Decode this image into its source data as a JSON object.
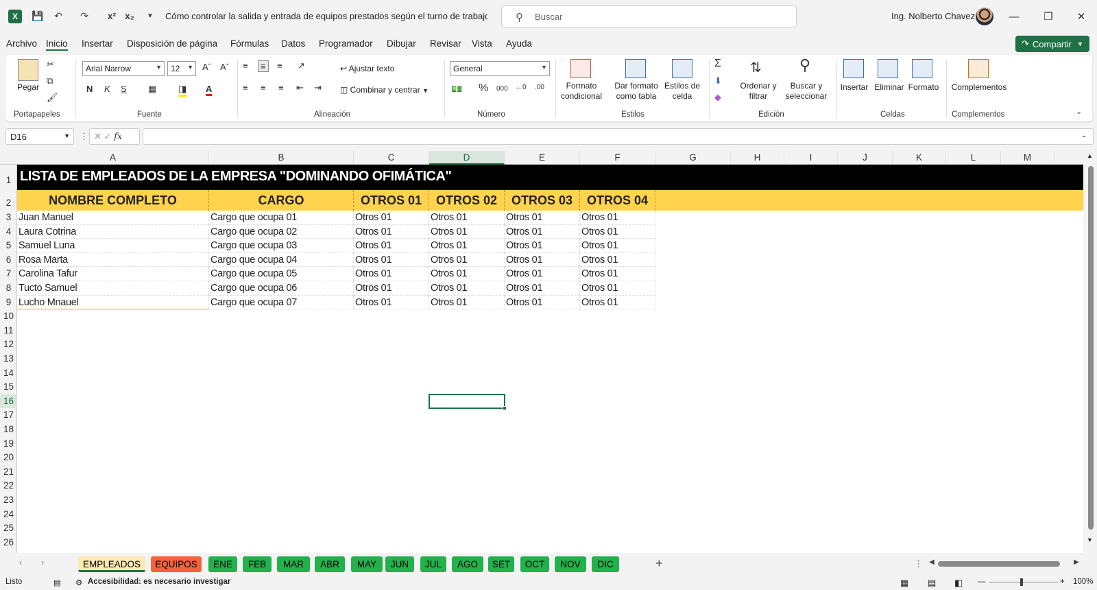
{
  "app": {
    "doc_title": "Cómo controlar la salida y entrada de equipos prestados según el turno de trabajo  -  E...",
    "search_placeholder": "Buscar",
    "user": "Ing. Nolberto Chavez",
    "share_label": "Compartir",
    "accent": "#1e7145"
  },
  "menu": [
    "Archivo",
    "Inicio",
    "Insertar",
    "Disposición de página",
    "Fórmulas",
    "Datos",
    "Programador",
    "Dibujar",
    "Revisar",
    "Vista",
    "Ayuda"
  ],
  "ribbon": {
    "groups": [
      "Portapapeles",
      "Fuente",
      "Alineación",
      "Número",
      "Estilos",
      "Edición",
      "Celdas",
      "Complementos"
    ],
    "paste": "Pegar",
    "font_name": "Arial Narrow",
    "font_size": "12",
    "bold": "N",
    "italic": "K",
    "underline": "S",
    "wrap_text": "Ajustar texto",
    "merge_center": "Combinar y centrar",
    "number_format": "General",
    "cond_format": [
      "Formato",
      "condicional"
    ],
    "table_format": [
      "Dar formato",
      "como tabla"
    ],
    "cell_styles": [
      "Estilos de",
      "celda"
    ],
    "sort_filter": [
      "Ordenar y",
      "filtrar"
    ],
    "find_select": [
      "Buscar y",
      "seleccionar"
    ],
    "insert": "Insertar",
    "delete": "Eliminar",
    "format": "Formato",
    "addins": "Complementos"
  },
  "formula_bar": {
    "name_box": "D16",
    "fx": "fx",
    "value": ""
  },
  "columns": [
    "A",
    "B",
    "C",
    "D",
    "E",
    "F",
    "G",
    "H",
    "I",
    "J",
    "K",
    "L",
    "M"
  ],
  "selected_column": "D",
  "rows": [
    "1",
    "2",
    "3",
    "4",
    "5",
    "6",
    "7",
    "8",
    "9",
    "10",
    "11",
    "12",
    "13",
    "14",
    "15",
    "16",
    "17",
    "18",
    "19",
    "20",
    "21",
    "22",
    "23",
    "24",
    "25",
    "26"
  ],
  "selected_row": "16",
  "sheet": {
    "title": "LISTA DE EMPLEADOS DE LA EMPRESA \"DOMINANDO OFIMÁTICA\"",
    "headers": [
      "NOMBRE COMPLETO",
      "CARGO",
      "OTROS 01",
      "OTROS 02",
      "OTROS 03",
      "OTROS 04"
    ],
    "data": [
      [
        "Juan Manuel",
        "Cargo que ocupa 01",
        "Otros 01",
        "Otros 01",
        "Otros 01",
        "Otros 01"
      ],
      [
        "Laura Cotrina",
        "Cargo que ocupa 02",
        "Otros 01",
        "Otros 01",
        "Otros 01",
        "Otros 01"
      ],
      [
        "Samuel Luna",
        "Cargo que ocupa 03",
        "Otros 01",
        "Otros 01",
        "Otros 01",
        "Otros 01"
      ],
      [
        "Rosa Marta",
        "Cargo que ocupa 04",
        "Otros 01",
        "Otros 01",
        "Otros 01",
        "Otros 01"
      ],
      [
        "Carolina Tafur",
        "Cargo que ocupa 05",
        "Otros 01",
        "Otros 01",
        "Otros 01",
        "Otros 01"
      ],
      [
        "Tucto Samuel",
        "Cargo que ocupa 06",
        "Otros 01",
        "Otros 01",
        "Otros 01",
        "Otros 01"
      ],
      [
        "Lucho Mnauel",
        "Cargo que ocupa 07",
        "Otros 01",
        "Otros 01",
        "Otros 01",
        "Otros 01"
      ]
    ],
    "title_bg": "#000000",
    "header_bg": "#ffd34d"
  },
  "tabs": [
    {
      "label": "EMPLEADOS",
      "color": "#fde9b3",
      "active": true
    },
    {
      "label": "EQUIPOS",
      "color": "#f4623a"
    },
    {
      "label": "ENE",
      "color": "#22b14c"
    },
    {
      "label": "FEB",
      "color": "#22b14c"
    },
    {
      "label": "MAR",
      "color": "#22b14c"
    },
    {
      "label": "ABR",
      "color": "#22b14c"
    },
    {
      "label": "MAY",
      "color": "#22b14c"
    },
    {
      "label": "JUN",
      "color": "#22b14c"
    },
    {
      "label": "JUL",
      "color": "#22b14c"
    },
    {
      "label": "AGO",
      "color": "#22b14c"
    },
    {
      "label": "SET",
      "color": "#22b14c"
    },
    {
      "label": "OCT",
      "color": "#22b14c"
    },
    {
      "label": "NOV",
      "color": "#22b14c"
    },
    {
      "label": "DIC",
      "color": "#22b14c"
    }
  ],
  "add_sheet": "+",
  "status": {
    "ready": "Listo",
    "accessibility": "Accesibilidad: es necesario investigar",
    "zoom": "100%"
  }
}
